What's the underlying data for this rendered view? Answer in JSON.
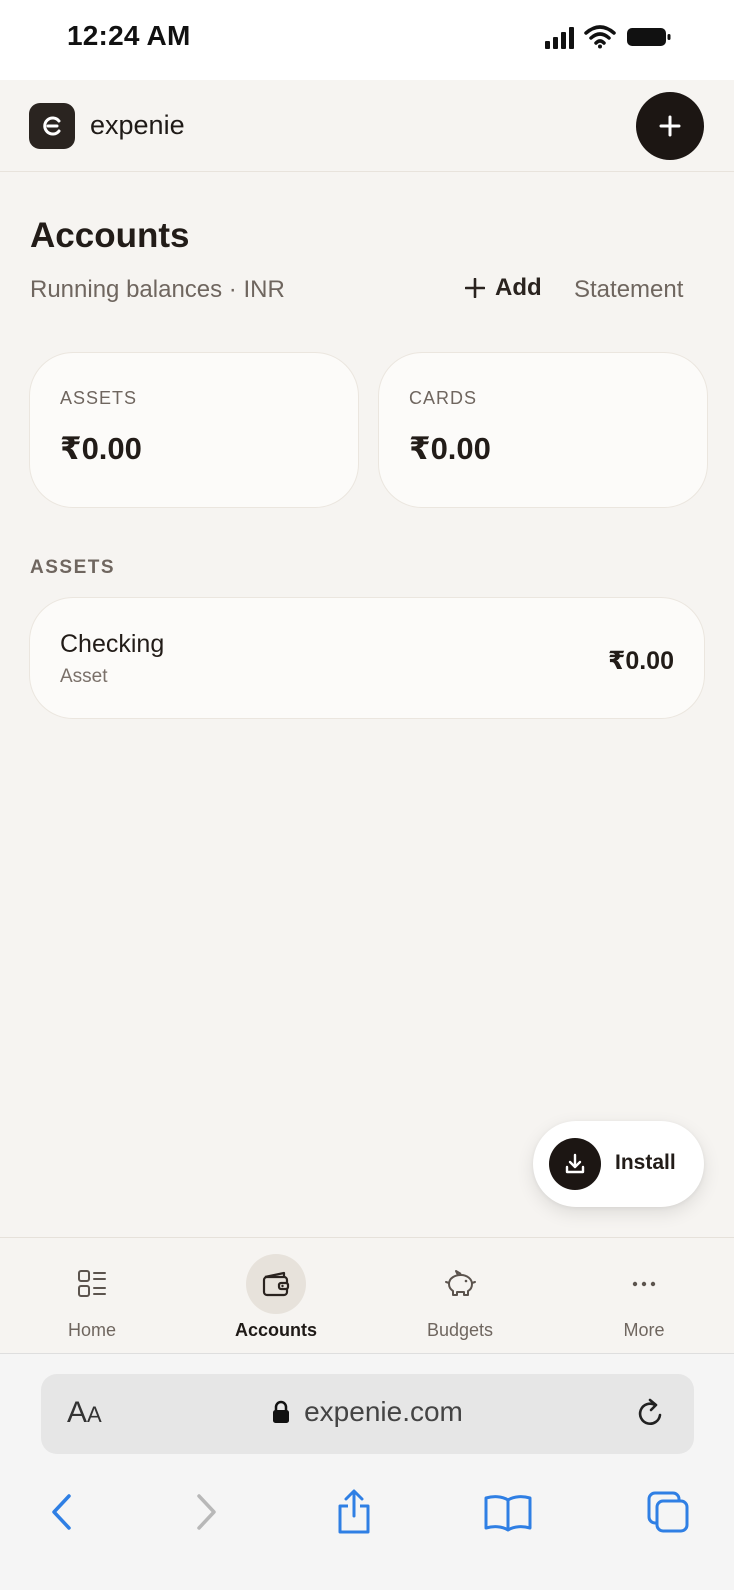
{
  "status_bar": {
    "time": "12:24 AM"
  },
  "header": {
    "logo_letter": "e",
    "brand": "expenie"
  },
  "page": {
    "title": "Accounts",
    "subtitle": "Running balances · INR",
    "add_label": "Add",
    "statement_label": "Statement"
  },
  "summary": [
    {
      "label": "ASSETS",
      "value": "₹0.00"
    },
    {
      "label": "CARDS",
      "value": "₹0.00"
    }
  ],
  "section": {
    "heading": "ASSETS"
  },
  "accounts": [
    {
      "name": "Checking",
      "type": "Asset",
      "balance": "₹0.00"
    }
  ],
  "install": {
    "label": "Install"
  },
  "tabs": [
    {
      "label": "Home",
      "icon": "home-grid-icon",
      "active": false
    },
    {
      "label": "Accounts",
      "icon": "wallet-icon",
      "active": true
    },
    {
      "label": "Budgets",
      "icon": "piggy-bank-icon",
      "active": false
    },
    {
      "label": "More",
      "icon": "more-dots-icon",
      "active": false
    }
  ],
  "browser": {
    "aa_label_big": "A",
    "aa_label_small": "A",
    "url": "expenie.com"
  },
  "colors": {
    "background": "#f6f4f1",
    "accent_dark": "#1c1613",
    "safari_blue": "#2f7fe4"
  }
}
